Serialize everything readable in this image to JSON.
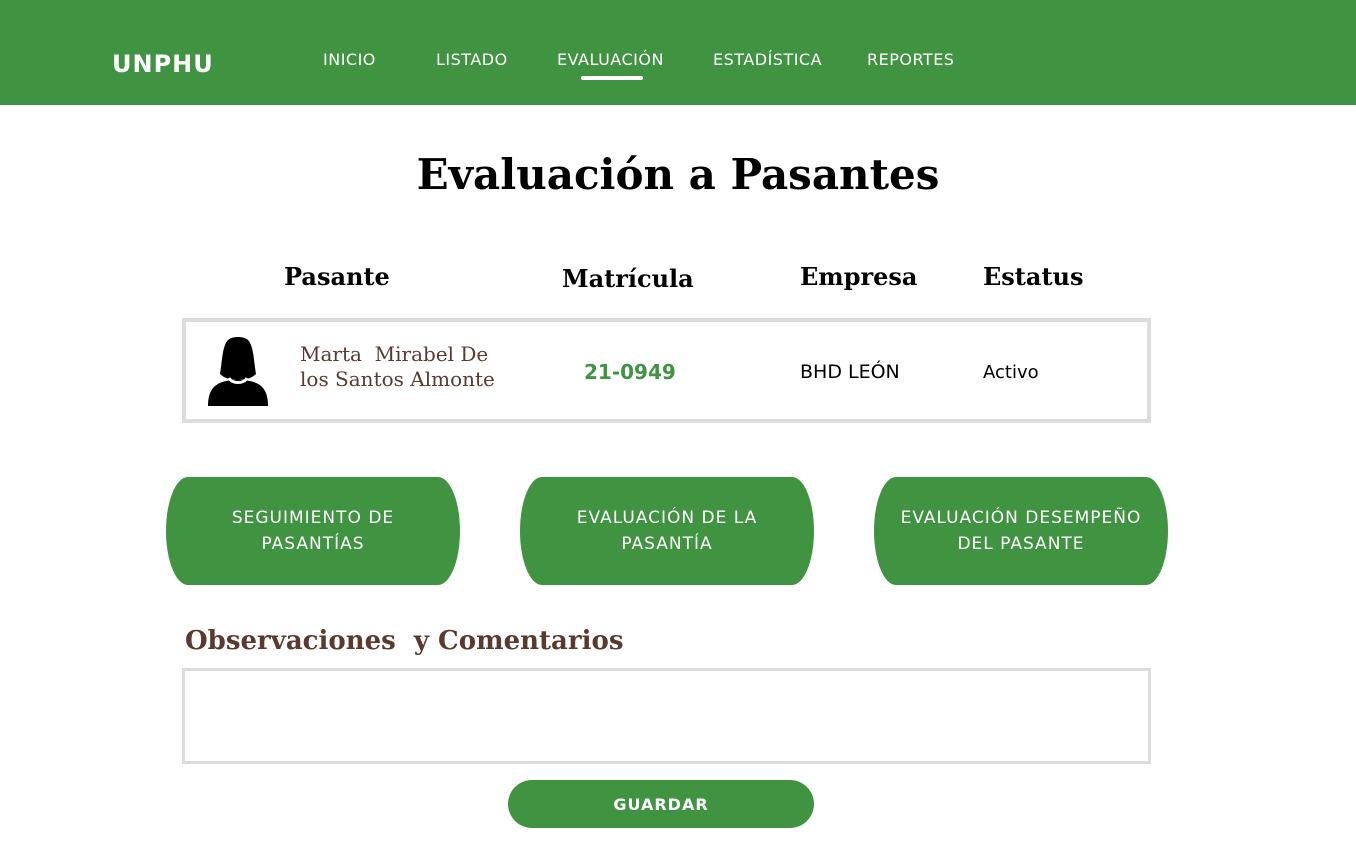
{
  "brand": "UNPHU",
  "nav": {
    "items": [
      {
        "label": "INICIO"
      },
      {
        "label": "LISTADO"
      },
      {
        "label": "EVALUACIÓN"
      },
      {
        "label": "ESTADÍSTICA"
      },
      {
        "label": "REPORTES"
      }
    ],
    "active": "EVALUACIÓN"
  },
  "page": {
    "title": "Evaluación a Pasantes"
  },
  "table": {
    "headers": {
      "pasante": "Pasante",
      "matricula": "Matrícula",
      "empresa": "Empresa",
      "estatus": "Estatus"
    },
    "record": {
      "name_line1": "Marta  Mirabel De",
      "name_line2": "los Santos Almonte",
      "matricula": "21-0949",
      "empresa": "BHD LEÓN",
      "estatus": "Activo",
      "avatar_icon": "user-silhouette-icon"
    }
  },
  "actions": {
    "seguimiento_line1": "SEGUIMIENTO DE",
    "seguimiento_line2": "PASANTÍAS",
    "evaluacion_line1": "EVALUACIÓN DE LA",
    "evaluacion_line2": "PASANTÍA",
    "desempeno_line1": "EVALUACIÓN DESEMPEÑO",
    "desempeno_line2": "DEL PASANTE"
  },
  "observaciones": {
    "title": "Observaciones  y Comentarios",
    "value": "",
    "placeholder": ""
  },
  "save_button": "GUARDAR",
  "colors": {
    "primary_green": "#409341",
    "heading_brown": "#5a3a2e",
    "border_gray": "#dcdcdc"
  }
}
